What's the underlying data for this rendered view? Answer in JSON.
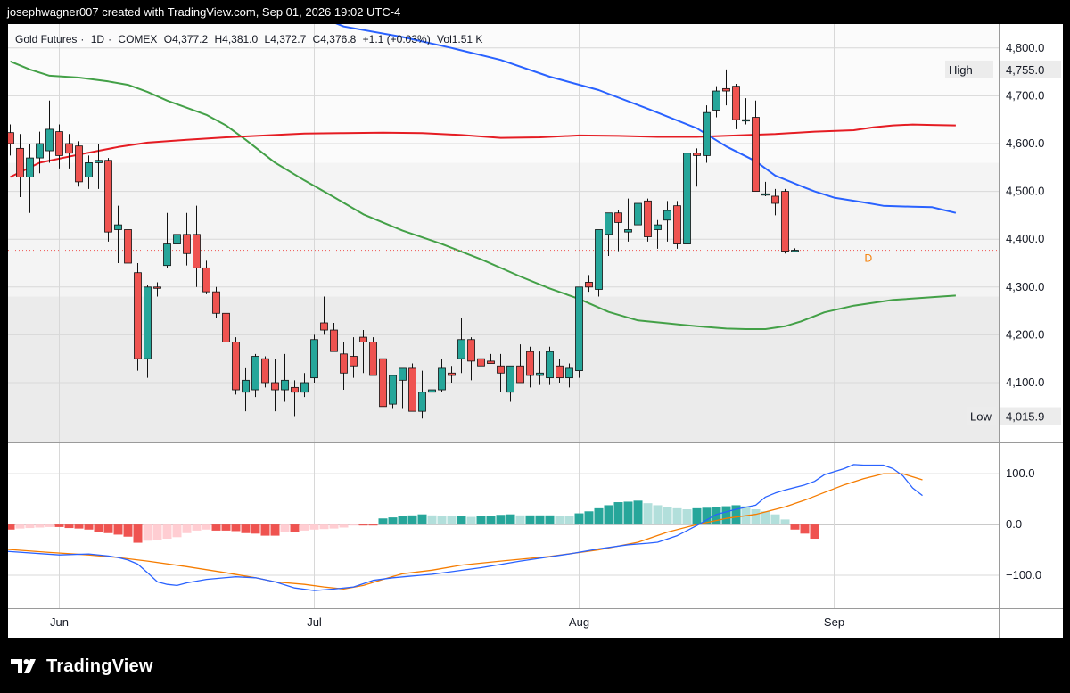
{
  "header": {
    "text": "josephwagner007 created with TradingView.com, Sep 01, 2026 19:02 UTC-4"
  },
  "legend": {
    "symbol": "Gold Futures",
    "interval": "1D",
    "exchange": "COMEX",
    "open": "O4,377.2",
    "high": "H4,381.0",
    "low": "L4,372.7",
    "close": "C4,376.8",
    "change": "+1.1 (+0.03%)",
    "volume": "Vol1.51 K"
  },
  "footer": {
    "brand": "TradingView"
  },
  "colors": {
    "up": "#26a69a",
    "up_dark": "#0f8a6e",
    "down": "#ef5350",
    "ma_blue": "#2962ff",
    "ma_red": "#e51c23",
    "ma_green": "#43a047",
    "macd": "#2962ff",
    "signal": "#f57c00",
    "hist_up_strong": "#26a69a",
    "hist_up_weak": "#b2dfdb",
    "hist_down_strong": "#ef5350",
    "hist_down_weak": "#ffcdd2"
  },
  "chart_data": [
    {
      "type": "candlestick",
      "ylim": [
        3975,
        4850
      ],
      "y_ticks": [
        "4,800.0",
        "4,700.0",
        "4,600.0",
        "4,500.0",
        "4,400.0",
        "4,300.0",
        "4,200.0",
        "4,100.0"
      ],
      "x_ticks": [
        "Jun",
        "Jul",
        "Aug",
        "Sep"
      ],
      "high_label": "High",
      "high_value": "4,755.0",
      "low_label": "Low",
      "low_value": "4,015.9",
      "session_marker": "D",
      "last_price": 4376.8,
      "candles": [
        [
          4623,
          4640,
          4575,
          4600
        ],
        [
          4590,
          4620,
          4488,
          4530
        ],
        [
          4530,
          4600,
          4455,
          4570
        ],
        [
          4570,
          4625,
          4538,
          4600
        ],
        [
          4585,
          4690,
          4560,
          4630
        ],
        [
          4625,
          4640,
          4548,
          4575
        ],
        [
          4600,
          4620,
          4548,
          4580
        ],
        [
          4595,
          4605,
          4510,
          4520
        ],
        [
          4530,
          4575,
          4505,
          4560
        ],
        [
          4560,
          4600,
          4505,
          4565
        ],
        [
          4565,
          4570,
          4395,
          4415
        ],
        [
          4420,
          4470,
          4350,
          4430
        ],
        [
          4420,
          4450,
          4345,
          4350
        ],
        [
          4330,
          4350,
          4125,
          4150
        ],
        [
          4150,
          4305,
          4110,
          4300
        ],
        [
          4300,
          4310,
          4280,
          4298
        ],
        [
          4345,
          4455,
          4340,
          4390
        ],
        [
          4390,
          4450,
          4370,
          4410
        ],
        [
          4410,
          4455,
          4345,
          4370
        ],
        [
          4410,
          4470,
          4300,
          4340
        ],
        [
          4340,
          4355,
          4285,
          4290
        ],
        [
          4290,
          4300,
          4235,
          4245
        ],
        [
          4245,
          4285,
          4165,
          4185
        ],
        [
          4185,
          4195,
          4075,
          4085
        ],
        [
          4080,
          4130,
          4040,
          4105
        ],
        [
          4085,
          4160,
          4070,
          4155
        ],
        [
          4150,
          4155,
          4090,
          4100
        ],
        [
          4100,
          4150,
          4040,
          4085
        ],
        [
          4085,
          4160,
          4060,
          4105
        ],
        [
          4090,
          4105,
          4030,
          4080
        ],
        [
          4080,
          4120,
          4070,
          4100
        ],
        [
          4110,
          4200,
          4100,
          4190
        ],
        [
          4225,
          4280,
          4200,
          4210
        ],
        [
          4210,
          4225,
          4170,
          4165
        ],
        [
          4160,
          4185,
          4085,
          4120
        ],
        [
          4155,
          4195,
          4110,
          4135
        ],
        [
          4195,
          4210,
          4120,
          4185
        ],
        [
          4185,
          4195,
          4130,
          4115
        ],
        [
          4150,
          4180,
          4050,
          4050
        ],
        [
          4055,
          4110,
          4045,
          4115
        ],
        [
          4105,
          4110,
          4045,
          4130
        ],
        [
          4130,
          4140,
          4045,
          4040
        ],
        [
          4040,
          4125,
          4025,
          4080
        ],
        [
          4080,
          4120,
          4070,
          4085
        ],
        [
          4085,
          4150,
          4080,
          4130
        ],
        [
          4120,
          4135,
          4100,
          4115
        ],
        [
          4150,
          4235,
          4120,
          4190
        ],
        [
          4190,
          4195,
          4105,
          4145
        ],
        [
          4150,
          4160,
          4115,
          4135
        ],
        [
          4145,
          4160,
          4140,
          4140
        ],
        [
          4135,
          4160,
          4080,
          4120
        ],
        [
          4080,
          4110,
          4060,
          4135
        ],
        [
          4135,
          4180,
          4110,
          4100
        ],
        [
          4165,
          4175,
          4090,
          4115
        ],
        [
          4115,
          4165,
          4095,
          4120
        ],
        [
          4110,
          4175,
          4095,
          4165
        ],
        [
          4135,
          4150,
          4100,
          4110
        ],
        [
          4110,
          4140,
          4090,
          4130
        ],
        [
          4125,
          4300,
          4110,
          4300
        ],
        [
          4310,
          4325,
          4290,
          4300
        ],
        [
          4295,
          4375,
          4280,
          4420
        ],
        [
          4410,
          4445,
          4365,
          4455
        ],
        [
          4455,
          4460,
          4375,
          4435
        ],
        [
          4415,
          4485,
          4395,
          4420
        ],
        [
          4430,
          4490,
          4395,
          4475
        ],
        [
          4480,
          4485,
          4395,
          4405
        ],
        [
          4420,
          4440,
          4380,
          4430
        ],
        [
          4440,
          4480,
          4395,
          4460
        ],
        [
          4470,
          4480,
          4380,
          4390
        ],
        [
          4390,
          4410,
          4380,
          4580
        ],
        [
          4580,
          4590,
          4510,
          4575
        ],
        [
          4575,
          4680,
          4560,
          4665
        ],
        [
          4670,
          4720,
          4655,
          4710
        ],
        [
          4715,
          4755,
          4680,
          4710
        ],
        [
          4720,
          4725,
          4630,
          4650
        ],
        [
          4650,
          4695,
          4640,
          4650
        ],
        [
          4655,
          4690,
          4615,
          4500
        ],
        [
          4495,
          4520,
          4490,
          4495
        ],
        [
          4490,
          4505,
          4450,
          4475
        ],
        [
          4500,
          4505,
          4370,
          4375
        ],
        [
          4377,
          4381,
          4373,
          4377
        ]
      ],
      "ma_blue": [
        [
          24,
          4900
        ],
        [
          31,
          4870
        ],
        [
          34,
          4845
        ],
        [
          40,
          4823
        ],
        [
          45,
          4800
        ],
        [
          50,
          4775
        ],
        [
          55,
          4740
        ],
        [
          60,
          4712
        ],
        [
          65,
          4673
        ],
        [
          70,
          4632
        ],
        [
          73,
          4594
        ],
        [
          76,
          4563
        ],
        [
          78,
          4533
        ],
        [
          81,
          4508
        ],
        [
          82,
          4500
        ],
        [
          84,
          4487
        ],
        [
          87,
          4477
        ],
        [
          89,
          4470
        ],
        [
          92,
          4468
        ],
        [
          94,
          4467
        ],
        [
          95,
          4462
        ],
        [
          96.4,
          4455
        ]
      ],
      "ma_red": [
        [
          0,
          4530
        ],
        [
          3,
          4560
        ],
        [
          7,
          4577
        ],
        [
          11,
          4593
        ],
        [
          14,
          4602
        ],
        [
          18,
          4608
        ],
        [
          22,
          4613
        ],
        [
          26,
          4617
        ],
        [
          30,
          4621
        ],
        [
          34,
          4622
        ],
        [
          38,
          4623
        ],
        [
          42,
          4622
        ],
        [
          46,
          4618
        ],
        [
          50,
          4612
        ],
        [
          54,
          4613
        ],
        [
          58,
          4617
        ],
        [
          62,
          4616
        ],
        [
          66,
          4614
        ],
        [
          70,
          4614
        ],
        [
          74,
          4617
        ],
        [
          78,
          4620
        ],
        [
          82,
          4625
        ],
        [
          86,
          4628
        ],
        [
          88,
          4634
        ],
        [
          90,
          4638
        ],
        [
          92,
          4640
        ],
        [
          94,
          4639
        ],
        [
          96.4,
          4638
        ]
      ],
      "ma_green": [
        [
          0,
          4772
        ],
        [
          2,
          4755
        ],
        [
          4,
          4742
        ],
        [
          7,
          4738
        ],
        [
          10,
          4730
        ],
        [
          12,
          4723
        ],
        [
          14,
          4708
        ],
        [
          16,
          4690
        ],
        [
          18,
          4675
        ],
        [
          20,
          4660
        ],
        [
          22,
          4638
        ],
        [
          24,
          4608
        ],
        [
          27,
          4560
        ],
        [
          30,
          4523
        ],
        [
          33,
          4488
        ],
        [
          36,
          4452
        ],
        [
          40,
          4418
        ],
        [
          44,
          4390
        ],
        [
          48,
          4358
        ],
        [
          52,
          4322
        ],
        [
          55,
          4297
        ],
        [
          58,
          4275
        ],
        [
          61,
          4248
        ],
        [
          64,
          4230
        ],
        [
          67,
          4224
        ],
        [
          70,
          4218
        ],
        [
          73,
          4213
        ],
        [
          75,
          4212
        ],
        [
          77,
          4212
        ],
        [
          79,
          4218
        ],
        [
          80.6,
          4228
        ],
        [
          83,
          4247
        ],
        [
          86,
          4261
        ],
        [
          90,
          4273
        ],
        [
          96.4,
          4282
        ]
      ]
    },
    {
      "type": "bar+line",
      "ylim": [
        -165,
        160
      ],
      "y_ticks": [
        "100.0",
        "0.0",
        "−100.0"
      ],
      "histogram": [
        -10,
        -8,
        -7,
        -6,
        -5,
        -5,
        -7,
        -8,
        -10,
        -15,
        -17,
        -20,
        -24,
        -36,
        -32,
        -30,
        -28,
        -25,
        -17,
        -12,
        -10,
        -12,
        -12,
        -13,
        -17,
        -18,
        -22,
        -22,
        -15,
        -15,
        -12,
        -10,
        -9,
        -8,
        -6,
        -2,
        -2,
        -2,
        12,
        14,
        16,
        18,
        20,
        18,
        17,
        16,
        16,
        15,
        16,
        16,
        19,
        20,
        18,
        18,
        18,
        18,
        17,
        16,
        22,
        26,
        32,
        38,
        44,
        45,
        47,
        42,
        38,
        35,
        32,
        30,
        32,
        33,
        34,
        36,
        38,
        36,
        30,
        26,
        20,
        10,
        -10,
        -18,
        -28
      ],
      "macd_points": [
        [
          -1,
          -52
        ],
        [
          5,
          -60
        ],
        [
          8,
          -58
        ],
        [
          10,
          -62
        ],
        [
          11,
          -65
        ],
        [
          12,
          -70
        ],
        [
          13,
          -78
        ],
        [
          14,
          -95
        ],
        [
          15,
          -113
        ],
        [
          16,
          -118
        ],
        [
          17,
          -120
        ],
        [
          18,
          -115
        ],
        [
          20,
          -108
        ],
        [
          23,
          -103
        ],
        [
          25,
          -105
        ],
        [
          27,
          -113
        ],
        [
          29,
          -125
        ],
        [
          31,
          -130
        ],
        [
          33,
          -127
        ],
        [
          35,
          -123
        ],
        [
          37,
          -110
        ],
        [
          39,
          -105
        ],
        [
          43,
          -98
        ],
        [
          48,
          -85
        ],
        [
          52,
          -72
        ],
        [
          57,
          -58
        ],
        [
          60,
          -48
        ],
        [
          63,
          -40
        ],
        [
          65,
          -37
        ],
        [
          66,
          -35
        ],
        [
          68,
          -22
        ],
        [
          70,
          -2
        ],
        [
          72,
          20
        ],
        [
          74,
          30
        ],
        [
          76,
          38
        ],
        [
          77,
          54
        ],
        [
          78,
          62
        ],
        [
          79,
          68
        ],
        [
          81,
          78
        ],
        [
          82,
          85
        ],
        [
          83,
          98
        ],
        [
          85,
          110
        ],
        [
          86,
          118
        ],
        [
          87,
          117
        ],
        [
          89,
          117
        ],
        [
          90,
          110
        ],
        [
          91,
          96
        ],
        [
          92,
          72
        ],
        [
          93,
          57
        ]
      ],
      "signal_points": [
        [
          -1,
          -48
        ],
        [
          4,
          -55
        ],
        [
          8,
          -60
        ],
        [
          11,
          -65
        ],
        [
          14,
          -72
        ],
        [
          18,
          -83
        ],
        [
          22,
          -95
        ],
        [
          25,
          -105
        ],
        [
          27,
          -113
        ],
        [
          30,
          -118
        ],
        [
          32,
          -123
        ],
        [
          34,
          -127
        ],
        [
          36,
          -120
        ],
        [
          38,
          -108
        ],
        [
          40,
          -97
        ],
        [
          43,
          -90
        ],
        [
          46,
          -80
        ],
        [
          50,
          -72
        ],
        [
          55,
          -63
        ],
        [
          60,
          -50
        ],
        [
          64,
          -35
        ],
        [
          67,
          -15
        ],
        [
          70,
          0
        ],
        [
          73,
          12
        ],
        [
          76,
          20
        ],
        [
          79,
          35
        ],
        [
          81,
          48
        ],
        [
          83,
          63
        ],
        [
          85,
          78
        ],
        [
          87,
          90
        ],
        [
          89,
          100
        ],
        [
          91,
          100
        ],
        [
          93,
          88
        ]
      ]
    }
  ]
}
